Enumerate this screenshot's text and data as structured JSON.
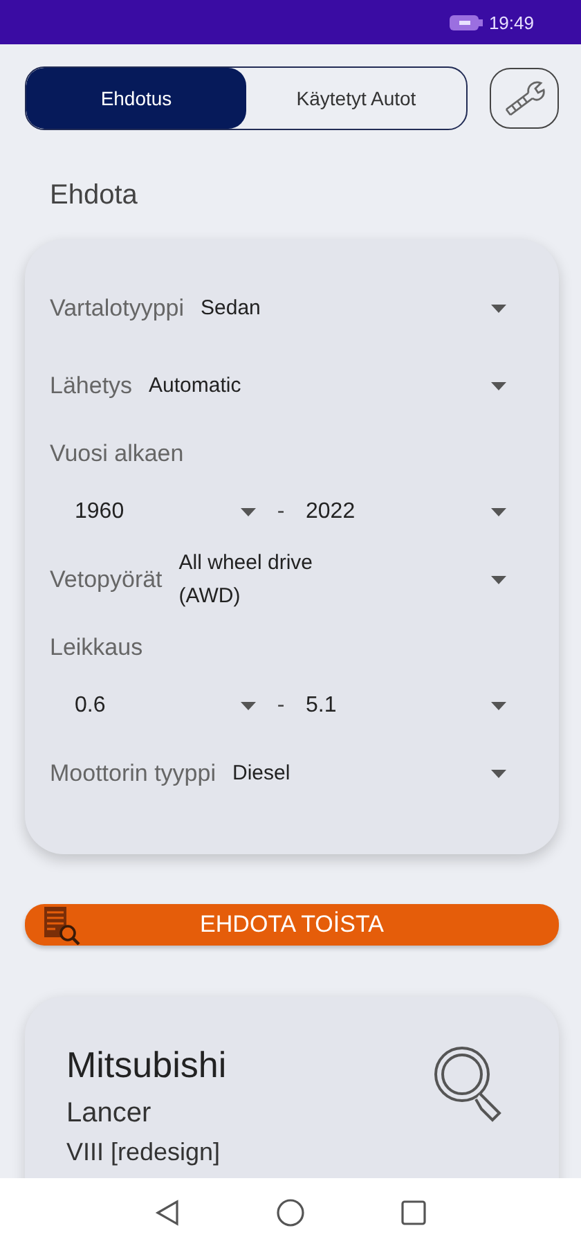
{
  "status_bar": {
    "time": "19:49"
  },
  "tabs": [
    {
      "label": "Ehdotus",
      "selected": true
    },
    {
      "label": "Käytetyt Autot",
      "selected": false
    }
  ],
  "section_title": "Ehdota",
  "filters": [
    {
      "kind": "select",
      "label": "Vartalotyyppi",
      "value": "Sedan"
    },
    {
      "kind": "select",
      "label": "Lähetys",
      "value": "Automatic"
    },
    {
      "kind": "range",
      "label": "Vuosi alkaen",
      "from": "1960",
      "separator": "-",
      "to": "2022"
    },
    {
      "kind": "select",
      "label": "Vetopyörät",
      "value": "All wheel drive (AWD)"
    },
    {
      "kind": "range",
      "label": "Leikkaus",
      "from": "0.6",
      "separator": "-",
      "to": "5.1"
    },
    {
      "kind": "select",
      "label": "Moottorin tyyppi",
      "value": "Diesel"
    }
  ],
  "suggest_button": {
    "label": "EHDOTA TOİSTA"
  },
  "result": {
    "make": "Mitsubishi",
    "model": "Lancer",
    "generation": "VIII [redesign]"
  }
}
